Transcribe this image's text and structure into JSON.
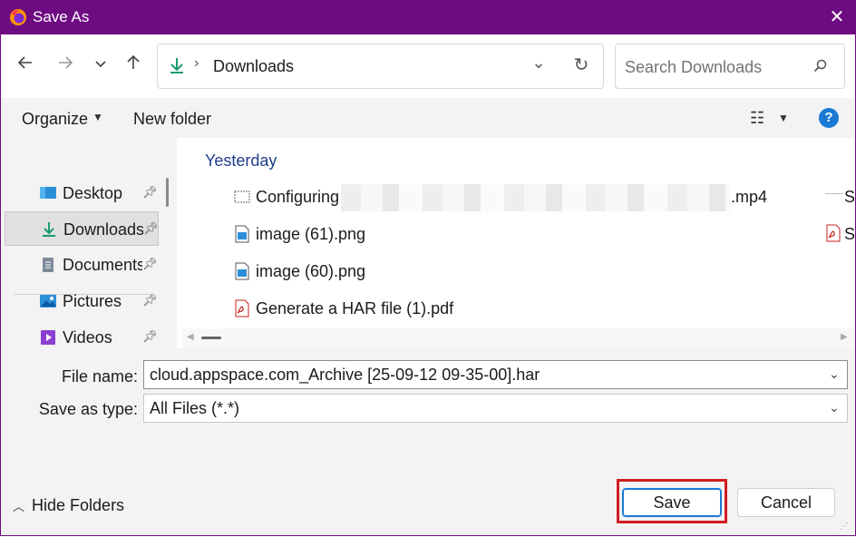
{
  "window": {
    "title": "Save As",
    "accent": "#6e0a82"
  },
  "nav": {
    "back_icon": "arrow-left-icon",
    "forward_icon": "arrow-right-icon",
    "recent_icon": "chevron-down-icon",
    "up_icon": "arrow-up-icon"
  },
  "address": {
    "location": "Downloads"
  },
  "search": {
    "placeholder": "Search Downloads"
  },
  "toolbar": {
    "organize": "Organize",
    "new_folder": "New folder"
  },
  "sidebar": {
    "items": [
      {
        "label": "Desktop",
        "icon": "desktop-icon"
      },
      {
        "label": "Downloads",
        "icon": "download-icon",
        "selected": true
      },
      {
        "label": "Documents",
        "icon": "documents-icon"
      },
      {
        "label": "Pictures",
        "icon": "pictures-icon"
      },
      {
        "label": "Videos",
        "icon": "videos-icon"
      }
    ]
  },
  "files": {
    "group": "Yesterday",
    "items": [
      {
        "name_start": "Configuring",
        "name_end": ".mp4",
        "icon": "video-file-icon"
      },
      {
        "name": "image (61).png",
        "icon": "image-file-icon"
      },
      {
        "name": "image (60).png",
        "icon": "image-file-icon"
      },
      {
        "name": "Generate a HAR file (1).pdf",
        "icon": "pdf-file-icon"
      }
    ],
    "cut_off_right": [
      "S",
      "S"
    ]
  },
  "form": {
    "file_name_label": "File name:",
    "file_name_value": "cloud.appspace.com_Archive [25-09-12 09-35-00].har",
    "type_label": "Save as type:",
    "type_value": "All Files (*.*)"
  },
  "footer": {
    "hide_folders": "Hide Folders",
    "save": "Save",
    "cancel": "Cancel"
  }
}
